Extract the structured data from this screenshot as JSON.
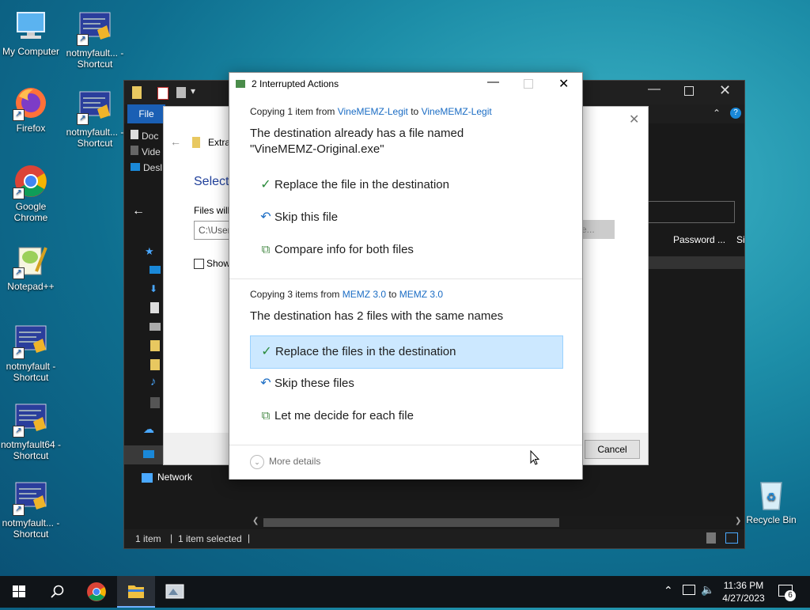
{
  "desktop": {
    "icons": [
      {
        "label": "My Computer"
      },
      {
        "label": "notmyfault... - Shortcut"
      },
      {
        "label": "Firefox"
      },
      {
        "label": "notmyfault... - Shortcut"
      },
      {
        "label": "Google Chrome"
      },
      {
        "label": "Notepad++"
      },
      {
        "label": "notmyfault - Shortcut"
      },
      {
        "label": "notmyfault64 - Shortcut"
      },
      {
        "label": "notmyfault... - Shortcut"
      },
      {
        "label": "Recycle Bin"
      }
    ]
  },
  "explorer": {
    "ribbon_file_tab": "File",
    "nav_items": [
      "Doc",
      "Vide",
      "Desl"
    ],
    "nav_network": "Network",
    "column_password": "Password ...",
    "column_size": "Si",
    "status_items": "1 item",
    "status_selected": "1 item selected"
  },
  "wizard": {
    "title_partial": "Extra",
    "heading_partial": "Select",
    "files_will_label": "Files will",
    "path_value": "C:\\User",
    "browse_partial": "se...",
    "show_checkbox_label": "Show",
    "cancel_label": "Cancel"
  },
  "dialog": {
    "title": "2 Interrupted Actions",
    "conflict1": {
      "copying_prefix": "Copying 1 item from ",
      "from": "VineMEMZ-Legit",
      "to_word": " to ",
      "to": "VineMEMZ-Legit",
      "message_line1": "The destination already has a file named",
      "message_line2": "\"VineMEMZ-Original.exe\"",
      "options": [
        {
          "label": "Replace the file in the destination",
          "icon": "check-icon"
        },
        {
          "label": "Skip this file",
          "icon": "skip-arrow-icon"
        },
        {
          "label": "Compare info for both files",
          "icon": "compare-files-icon"
        }
      ]
    },
    "conflict2": {
      "copying_prefix": "Copying 3 items from ",
      "from": "MEMZ 3.0",
      "to_word": " to ",
      "to": "MEMZ 3.0",
      "message": "The destination has 2 files with the same names",
      "options": [
        {
          "label": "Replace the files in the destination",
          "icon": "check-icon"
        },
        {
          "label": "Skip these files",
          "icon": "skip-arrow-icon"
        },
        {
          "label": "Let me decide for each file",
          "icon": "compare-files-icon"
        }
      ]
    },
    "more_details": "More details"
  },
  "taskbar": {
    "time": "11:36 PM",
    "date": "4/27/2023",
    "notification_count": "6"
  },
  "colors": {
    "accent_link": "#1a6cc4",
    "selected_bg": "#cce8ff",
    "check_green": "#2a8a3a"
  }
}
